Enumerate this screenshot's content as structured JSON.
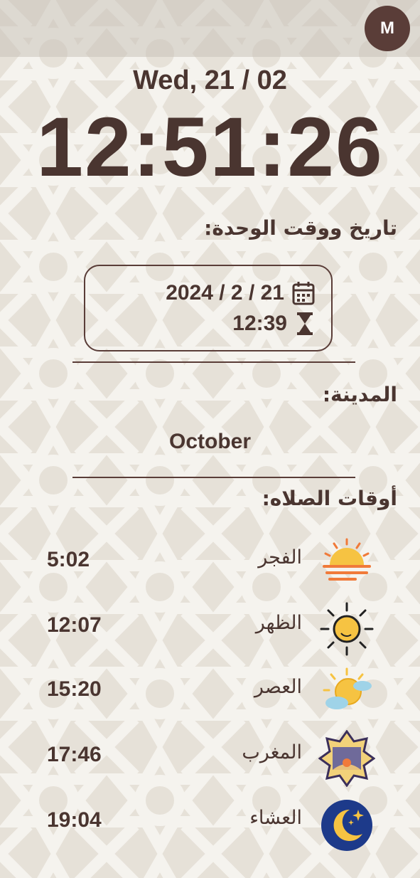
{
  "header": {
    "avatar_letter": "M"
  },
  "date": "Wed, 21 / 02",
  "clock": "12:51:26",
  "unit": {
    "title": "تاريخ ووقت الوحدة:",
    "date": "2024 / 2 / 21",
    "time": "12:39"
  },
  "city": {
    "title": "المدينة:",
    "value": "October"
  },
  "prayers": {
    "title": "أوقات الصلاه:",
    "items": [
      {
        "name": "الفجر",
        "time": "5:02",
        "icon": "sunrise-icon"
      },
      {
        "name": "الظهر",
        "time": "12:07",
        "icon": "sun-icon"
      },
      {
        "name": "العصر",
        "time": "15:20",
        "icon": "sun-cloud-icon"
      },
      {
        "name": "المغرب",
        "time": "17:46",
        "icon": "sunset-star-icon"
      },
      {
        "name": "العشاء",
        "time": "19:04",
        "icon": "moon-stars-icon"
      }
    ]
  },
  "colors": {
    "text": "#4a3530",
    "background": "#e9e5de",
    "avatar": "#5a3d38"
  }
}
